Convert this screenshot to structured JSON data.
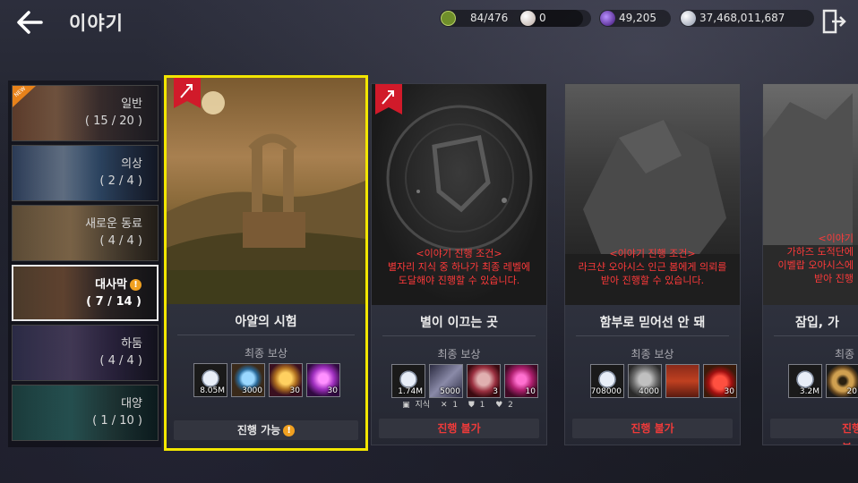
{
  "header": {
    "title": "이야기",
    "resources": [
      {
        "icon": "knowledge-icon",
        "value": "84/476",
        "color": "#8fae3a"
      },
      {
        "icon": "pearl-icon",
        "value": "0",
        "color": "#d8c8c0"
      },
      {
        "icon": "crystal-icon",
        "value": "49,205",
        "color": "#7a3bd0"
      },
      {
        "icon": "silver-icon",
        "value": "37,468,011,687",
        "color": "#c9d0dc"
      }
    ]
  },
  "categories": [
    {
      "name": "일반",
      "count": "( 15 / 20 )",
      "new_label": "NEW",
      "alert": false
    },
    {
      "name": "의상",
      "count": "( 2 / 4 )",
      "alert": false
    },
    {
      "name": "새로운 동료",
      "count": "( 4 / 4 )",
      "alert": false
    },
    {
      "name": "대사막",
      "count": "( 7 / 14 )",
      "alert": true,
      "alert_symbol": "!"
    },
    {
      "name": "하둠",
      "count": "( 4 / 4 )",
      "alert": false
    },
    {
      "name": "대양",
      "count": "( 1 / 10 )",
      "alert": false
    }
  ],
  "cards": [
    {
      "title": "아알의 시험",
      "reward_label": "최종 보상",
      "rewards": [
        {
          "icon": "silver-coin-icon",
          "value": "8.05M"
        },
        {
          "icon": "blue-crystal-icon",
          "value": "3000"
        },
        {
          "icon": "gold-chest-icon",
          "value": "30"
        },
        {
          "icon": "purple-crystal-icon",
          "value": "30"
        }
      ],
      "status": "진행 가능",
      "status_alert": "!",
      "locked": false
    },
    {
      "title": "별이 이끄는 곳",
      "reward_label": "최종 보상",
      "rewards": [
        {
          "icon": "silver-coin-icon",
          "value": "1.74M"
        },
        {
          "icon": "scroll-icon",
          "value": "5000"
        },
        {
          "icon": "red-box-icon",
          "value": "3"
        },
        {
          "icon": "pink-crystal-icon",
          "value": "10"
        }
      ],
      "requirements": [
        {
          "icon": "book-icon",
          "text": "지식"
        },
        {
          "icon": "swords-icon",
          "text": "1"
        },
        {
          "icon": "shield-icon",
          "text": "1"
        },
        {
          "icon": "heart-icon",
          "text": "2"
        }
      ],
      "lock_message": [
        "<이야기 진행 조건>",
        "별자리 지식 중 하나가 최종 레벨에",
        "도달해야 진행할 수 있습니다."
      ],
      "status": "진행 불가",
      "locked": true
    },
    {
      "title": "함부로 믿어선 안 돼",
      "reward_label": "최종 보상",
      "rewards": [
        {
          "icon": "silver-coin-icon",
          "value": "708000"
        },
        {
          "icon": "armor-icon",
          "value": "4000"
        },
        {
          "icon": "treasure-chest-icon",
          "value": ""
        },
        {
          "icon": "red-potion-icon",
          "value": "30"
        }
      ],
      "lock_message": [
        "<이야기 진행 조건>",
        "라크샨 오아시스 인근 봄에게 의뢰를",
        "받아 진행할 수 있습니다."
      ],
      "status": "진행 불가",
      "locked": true
    },
    {
      "title": "잠입, 가",
      "reward_label": "최종 보",
      "rewards": [
        {
          "icon": "silver-coin-icon",
          "value": "3.2M"
        },
        {
          "icon": "gold-ring-icon",
          "value": "20"
        }
      ],
      "lock_message": [
        "<이야기",
        "가하즈 도적단에",
        "이벨랍 오아시스에",
        "받아 진행"
      ],
      "status": "진행 불",
      "locked": true
    }
  ]
}
